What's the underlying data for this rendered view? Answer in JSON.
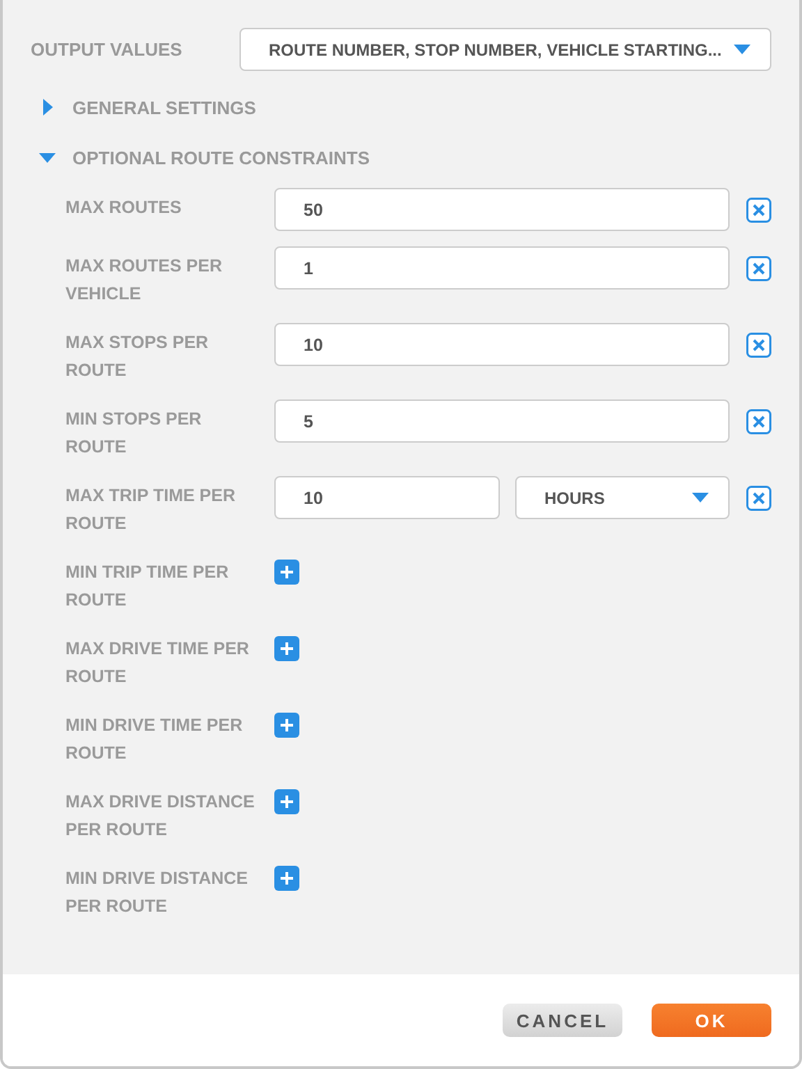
{
  "output_values": {
    "label": "OUTPUT VALUES",
    "value": "ROUTE NUMBER, STOP NUMBER, VEHICLE STARTING..."
  },
  "sections": [
    {
      "label": "GENERAL SETTINGS",
      "expanded": false
    },
    {
      "label": "OPTIONAL ROUTE CONSTRAINTS",
      "expanded": true,
      "constraints": [
        {
          "kind": "number",
          "label": "MAX ROUTES",
          "value": "50"
        },
        {
          "kind": "number",
          "label": "MAX ROUTES PER VEHICLE",
          "value": "1"
        },
        {
          "kind": "number",
          "label": "MAX STOPS PER ROUTE",
          "value": "10"
        },
        {
          "kind": "number",
          "label": "MIN STOPS PER ROUTE",
          "value": "5"
        },
        {
          "kind": "number_unit",
          "label": "MAX TRIP TIME PER ROUTE",
          "value": "10",
          "unit": "HOURS"
        },
        {
          "kind": "add",
          "label": "MIN TRIP TIME PER ROUTE"
        },
        {
          "kind": "add",
          "label": "MAX DRIVE TIME PER ROUTE"
        },
        {
          "kind": "add",
          "label": "MIN DRIVE TIME PER ROUTE"
        },
        {
          "kind": "add",
          "label": "MAX DRIVE DISTANCE PER ROUTE"
        },
        {
          "kind": "add",
          "label": "MIN DRIVE DISTANCE PER ROUTE"
        }
      ]
    }
  ],
  "buttons": [
    {
      "label": "CANCEL",
      "kind": "secondary"
    },
    {
      "label": "OK",
      "kind": "primary"
    }
  ]
}
